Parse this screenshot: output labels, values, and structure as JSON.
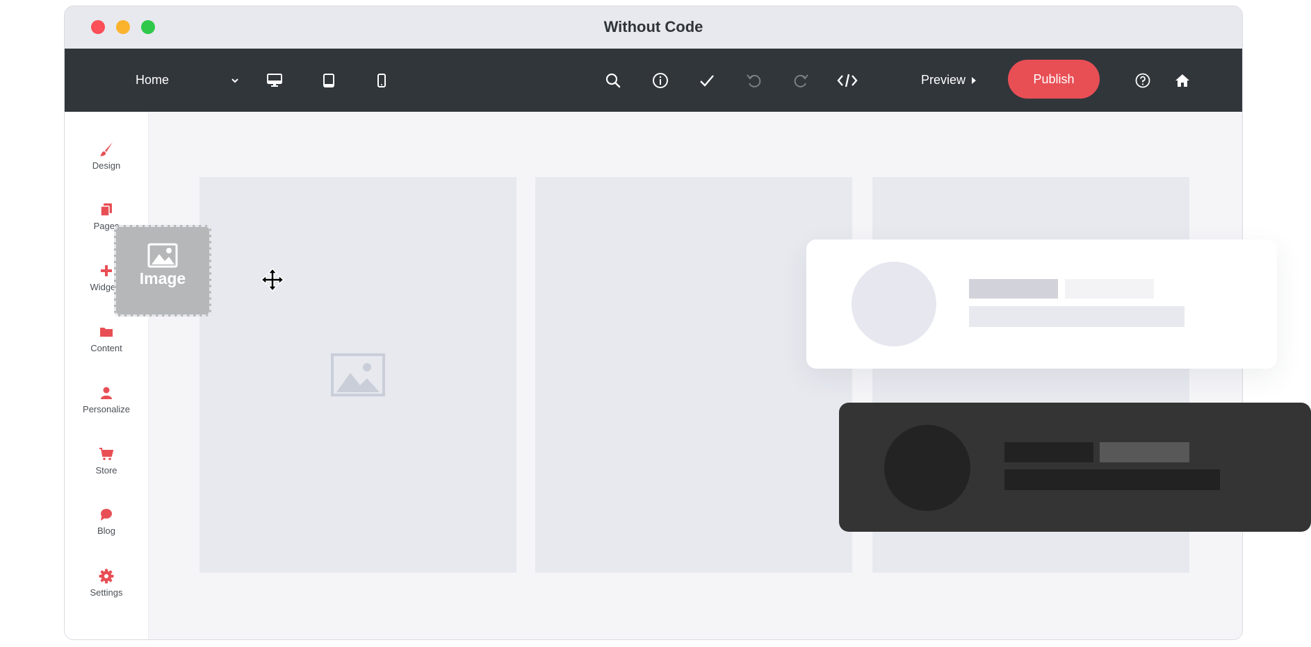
{
  "window": {
    "title": "Without Code"
  },
  "colors": {
    "accent": "#e84f55",
    "toolbar": "#31363b",
    "close": "#fc4f57",
    "minimize": "#fbb32e",
    "maximize": "#2fc84a"
  },
  "toolbar": {
    "page_select": "Home",
    "device_icons": [
      "desktop-icon",
      "tablet-icon",
      "mobile-icon"
    ],
    "tool_icons": [
      "search-icon",
      "info-icon",
      "check-icon",
      "undo-icon",
      "redo-icon",
      "code-icon"
    ],
    "preview_label": "Preview",
    "publish_label": "Publish",
    "right_icons": [
      "help-icon",
      "home-icon"
    ]
  },
  "sidebar": {
    "items": [
      {
        "label": "Design",
        "icon": "brush-icon"
      },
      {
        "label": "Pages",
        "icon": "pages-icon"
      },
      {
        "label": "Widgets",
        "icon": "plus-icon"
      },
      {
        "label": "Content",
        "icon": "folder-icon"
      },
      {
        "label": "Personalize",
        "icon": "user-icon"
      },
      {
        "label": "Store",
        "icon": "cart-icon"
      },
      {
        "label": "Blog",
        "icon": "chat-bubble-icon"
      },
      {
        "label": "Settings",
        "icon": "gear-icon"
      }
    ]
  },
  "canvas": {
    "drag_widget_label": "Image"
  }
}
